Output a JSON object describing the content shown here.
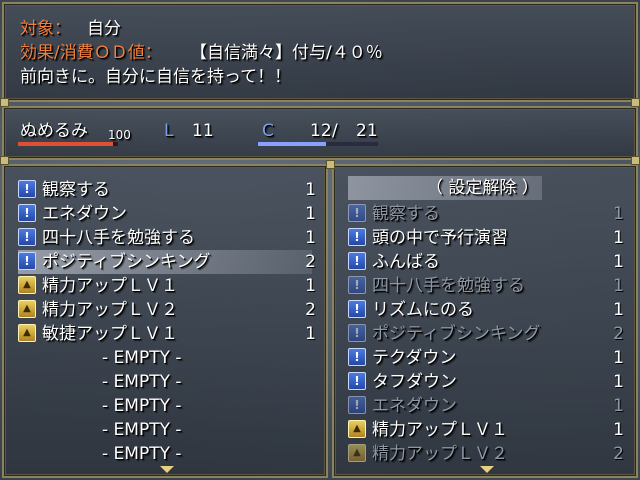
{
  "info": {
    "target_label": "対象：",
    "target_value": "自分",
    "od_label": "効果/消費ＯＤ値：",
    "od_value": "【自信満々】付与/４０％",
    "description": "前向きに。自分に自信を持って！！"
  },
  "status": {
    "name": "ぬめるみ",
    "hp_value": "100",
    "level_label": "L",
    "level": "11",
    "cost_label": "C",
    "cost_current": "12",
    "cost_sep": "/",
    "cost_max": "21",
    "hp_fill": 0.95,
    "cost_fill": 0.57,
    "colors": {
      "hp_bar": "#e05030",
      "cost_bar": "#8aa0ff",
      "label_blue": "#7aa0e8",
      "accent_orange": "#f08040"
    }
  },
  "equipped": {
    "items": [
      {
        "icon": "skill-icon",
        "label": "観察する",
        "count": "1",
        "selected": false
      },
      {
        "icon": "skill-icon",
        "label": "エネダウン",
        "count": "1",
        "selected": false
      },
      {
        "icon": "skill-icon",
        "label": "四十八手を勉強する",
        "count": "1",
        "selected": false
      },
      {
        "icon": "skill-icon",
        "label": "ポジティブシンキング",
        "count": "2",
        "selected": true
      },
      {
        "icon": "gai-up-icon",
        "label": "精力アップＬＶ１",
        "count": "1",
        "selected": false
      },
      {
        "icon": "gai-up-icon",
        "label": "精力アップＬＶ２",
        "count": "2",
        "selected": false
      },
      {
        "icon": "gai-up-icon",
        "label": "敏捷アップＬＶ１",
        "count": "1",
        "selected": false
      }
    ],
    "empty_slots": [
      "- EMPTY -",
      "- EMPTY -",
      "- EMPTY -",
      "- EMPTY -",
      "- EMPTY -"
    ]
  },
  "available": {
    "header": "（ 設定解除 ）",
    "items": [
      {
        "icon": "skill-icon",
        "label": "観察する",
        "count": "1",
        "dim": true
      },
      {
        "icon": "skill-icon",
        "label": "頭の中で予行演習",
        "count": "1",
        "dim": false
      },
      {
        "icon": "skill-icon",
        "label": "ふんばる",
        "count": "1",
        "dim": false
      },
      {
        "icon": "skill-icon",
        "label": "四十八手を勉強する",
        "count": "1",
        "dim": true
      },
      {
        "icon": "skill-icon",
        "label": "リズムにのる",
        "count": "1",
        "dim": false
      },
      {
        "icon": "skill-icon",
        "label": "ポジティブシンキング",
        "count": "2",
        "dim": true
      },
      {
        "icon": "skill-icon",
        "label": "テクダウン",
        "count": "1",
        "dim": false
      },
      {
        "icon": "skill-icon",
        "label": "タフダウン",
        "count": "1",
        "dim": false
      },
      {
        "icon": "skill-icon",
        "label": "エネダウン",
        "count": "1",
        "dim": true
      },
      {
        "icon": "gai-up-icon",
        "label": "精力アップＬＶ１",
        "count": "1",
        "dim": false
      },
      {
        "icon": "gai-up-icon",
        "label": "精力アップＬＶ２",
        "count": "2",
        "dim": true
      }
    ]
  }
}
